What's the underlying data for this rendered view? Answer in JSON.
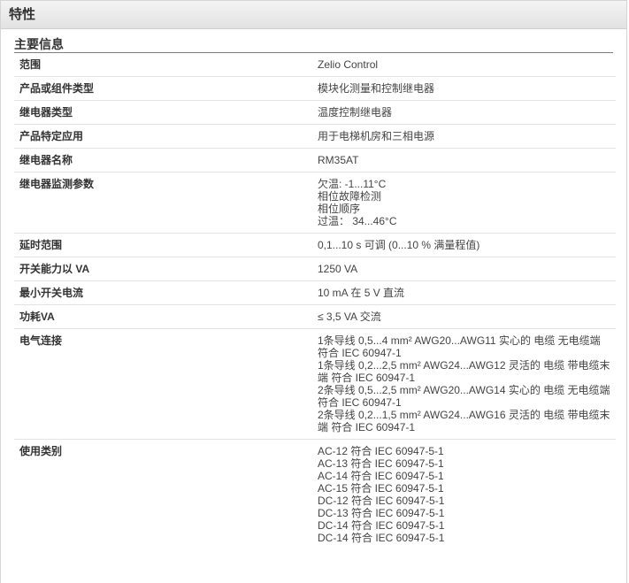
{
  "header": {
    "title": "特性"
  },
  "section": {
    "title": "主要信息"
  },
  "rows": [
    {
      "label": "范围",
      "lines": [
        "Zelio Control"
      ]
    },
    {
      "label": "产品或组件类型",
      "lines": [
        "模块化测量和控制继电器"
      ]
    },
    {
      "label": "继电器类型",
      "lines": [
        "温度控制继电器"
      ]
    },
    {
      "label": "产品特定应用",
      "lines": [
        "用于电梯机房和三相电源"
      ]
    },
    {
      "label": "继电器名称",
      "lines": [
        "RM35AT"
      ]
    },
    {
      "label": "继电器监测参数",
      "lines": [
        "欠温: -1...11°C",
        "相位故障检测",
        "相位顺序",
        "过温：  34...46°C"
      ]
    },
    {
      "label": "延时范围",
      "lines": [
        "0,1...10 s 可调 (0...10 % 满量程值)"
      ]
    },
    {
      "label": "开关能力以 VA",
      "lines": [
        "1250 VA"
      ]
    },
    {
      "label": "最小开关电流",
      "lines": [
        "10 mA 在 5 V 直流"
      ]
    },
    {
      "label": "功耗VA",
      "lines": [
        "≤ 3,5 VA 交流"
      ]
    },
    {
      "label": "电气连接",
      "lines": [
        "1条导线 0,5...4 mm² AWG20...AWG11 实心的 电缆 无电缆端",
        "符合 IEC 60947-1",
        "1条导线 0,2...2,5 mm² AWG24...AWG12 灵活的 电缆 带电缆末",
        "端 符合 IEC 60947-1",
        "2条导线 0,5...2,5 mm² AWG20...AWG14 实心的 电缆 无电缆端",
        "符合 IEC 60947-1",
        "2条导线 0,2...1,5 mm² AWG24...AWG16 灵活的 电缆 带电缆末",
        "端 符合 IEC 60947-1"
      ]
    },
    {
      "label": "使用类别",
      "lines": [
        "AC-12 符合 IEC 60947-5-1",
        "AC-13 符合 IEC 60947-5-1",
        "AC-14 符合 IEC 60947-5-1",
        "AC-15 符合 IEC 60947-5-1",
        "DC-12 符合 IEC 60947-5-1",
        "DC-13 符合 IEC 60947-5-1",
        "DC-14 符合 IEC 60947-5-1",
        "DC-14 符合 IEC 60947-5-1"
      ]
    }
  ]
}
